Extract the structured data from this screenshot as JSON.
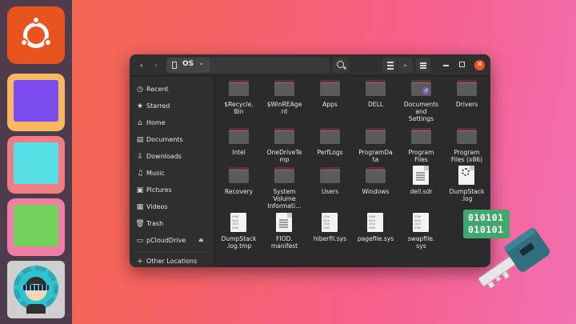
{
  "window": {
    "path_label": "OS"
  },
  "sidebar": {
    "items": [
      {
        "label": "Recent",
        "icon": "clock-icon"
      },
      {
        "label": "Starred",
        "icon": "star-icon"
      },
      {
        "label": "Home",
        "icon": "home-icon"
      },
      {
        "label": "Documents",
        "icon": "document-icon"
      },
      {
        "label": "Downloads",
        "icon": "download-icon"
      },
      {
        "label": "Music",
        "icon": "music-icon"
      },
      {
        "label": "Pictures",
        "icon": "picture-icon"
      },
      {
        "label": "Videos",
        "icon": "video-icon"
      },
      {
        "label": "Trash",
        "icon": "trash-icon"
      },
      {
        "label": "pCloudDrive",
        "icon": "drive-icon"
      },
      {
        "label": "Other Locations",
        "icon": "plus-icon"
      }
    ]
  },
  "files": [
    {
      "name": "$Recycle.\nBin",
      "kind": "folder"
    },
    {
      "name": "$WinREAge\nnt",
      "kind": "folder"
    },
    {
      "name": "Apps",
      "kind": "folder"
    },
    {
      "name": "DELL",
      "kind": "folder"
    },
    {
      "name": "Documents\nand\nSettings",
      "kind": "folder-link"
    },
    {
      "name": "Drivers",
      "kind": "folder"
    },
    {
      "name": "Intel",
      "kind": "folder"
    },
    {
      "name": "OneDriveTe\nmp",
      "kind": "folder"
    },
    {
      "name": "PerfLogs",
      "kind": "folder"
    },
    {
      "name": "ProgramDa\nta",
      "kind": "folder"
    },
    {
      "name": "Program\nFiles",
      "kind": "folder"
    },
    {
      "name": "Program\nFiles (x86)",
      "kind": "folder"
    },
    {
      "name": "Recovery",
      "kind": "folder"
    },
    {
      "name": "System\nVolume\nInformati…",
      "kind": "folder"
    },
    {
      "name": "Users",
      "kind": "folder"
    },
    {
      "name": "Windows",
      "kind": "folder"
    },
    {
      "name": "dell.sdr",
      "kind": "text"
    },
    {
      "name": "DumpStack\n.log",
      "kind": "config"
    },
    {
      "name": "DumpStack\n.log.tmp",
      "kind": "binary"
    },
    {
      "name": "FIOD.\nmanifest",
      "kind": "text"
    },
    {
      "name": "hiberfil.sys",
      "kind": "binary"
    },
    {
      "name": "pagefile.sys",
      "kind": "binary"
    },
    {
      "name": "swapfile.\nsys",
      "kind": "binary"
    }
  ],
  "binary_icon_text": "0100\n0010\n1010\n0100",
  "decoration": {
    "badge_line1": "010101",
    "badge_line2": "010101"
  },
  "colors": {
    "accent": "#e95420",
    "folder_tab": "#6a2e3b",
    "key": "#2f6f80",
    "badge": "#3fa86a"
  }
}
